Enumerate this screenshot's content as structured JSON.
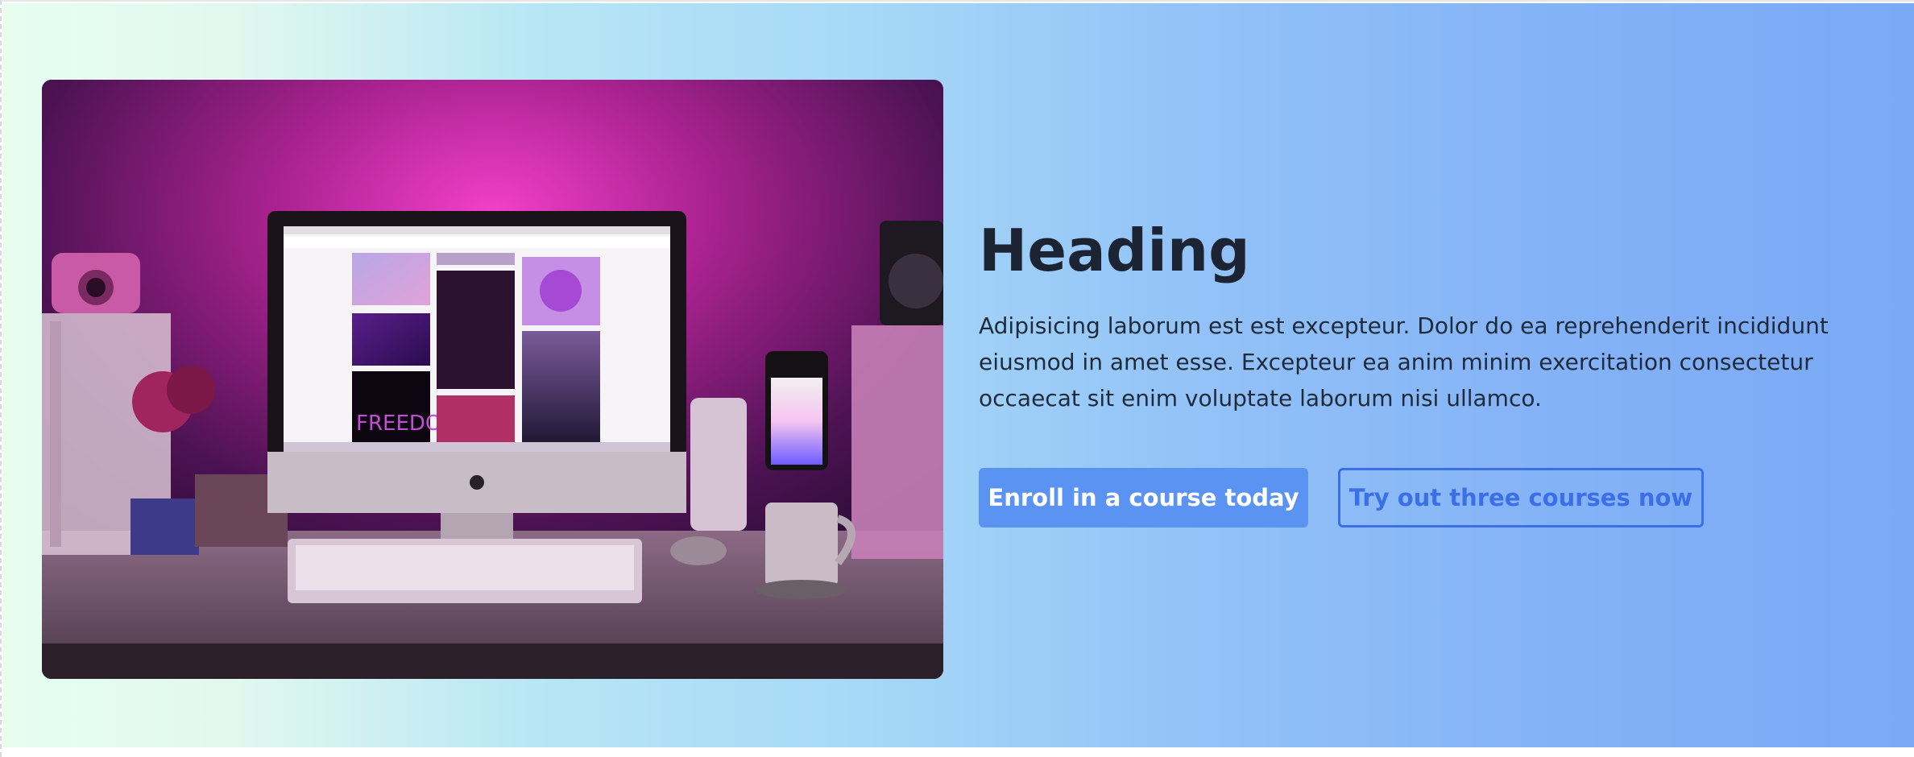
{
  "hero": {
    "heading": "Heading",
    "body": "Adipisicing laborum est est excepteur. Dolor do ea reprehenderit incididunt eiusmod in amet esse. Excepteur ea anim minim exercitation consectetur occaecat sit enim voluptate laborum nisi ullamco.",
    "primary_button": "Enroll in a course today",
    "secondary_button": "Try out three courses now"
  },
  "photo": {
    "screen_text": "FREEDOM"
  },
  "colors": {
    "gradient_start": "#e6fdf0",
    "gradient_end": "#7aa9f6",
    "primary": "#5b93f3",
    "outline": "#3b6fe6",
    "heading": "#1c2433"
  }
}
